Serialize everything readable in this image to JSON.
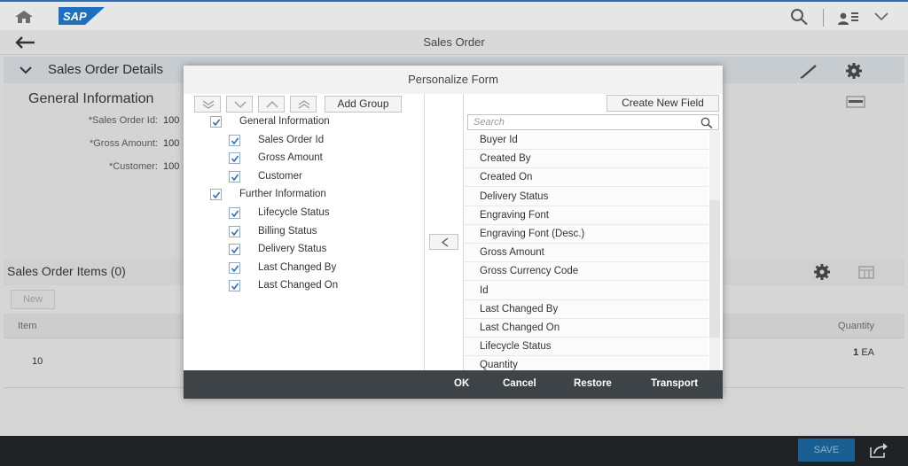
{
  "colors": {
    "accent": "#2a6ebb",
    "sap_blue": "#1f6fbf",
    "footer": "#1f2326",
    "dialog_footer": "#3d4347",
    "save": "#1a5f91",
    "checkbox": "#2a6ebb"
  },
  "shell": {
    "logo_text": "SAP",
    "icons": [
      "home-icon",
      "search-icon",
      "user-icon",
      "chevron-down-icon"
    ]
  },
  "nav": {
    "title": "Sales Order"
  },
  "section": {
    "title": "Sales Order Details"
  },
  "form": {
    "group_title": "General Information",
    "fields": [
      {
        "label": "*Sales Order Id:",
        "value": "100"
      },
      {
        "label": "*Gross Amount:",
        "value": "100"
      },
      {
        "label": "*Customer:",
        "value": "100"
      }
    ]
  },
  "items": {
    "title": "Sales Order Items (0)",
    "new_label": "New",
    "columns": {
      "item": "Item",
      "quantity": "Quantity"
    },
    "rows": [
      {
        "item": "10",
        "qty_value": "1",
        "qty_unit": "EA"
      }
    ]
  },
  "footer": {
    "save_label": "SAVE"
  },
  "dialog": {
    "title": "Personalize Form",
    "add_group_label": "Add Group",
    "create_field_label": "Create New Field",
    "search_placeholder": "Search",
    "tree": [
      {
        "label": "General Information",
        "level": 0,
        "checked": true
      },
      {
        "label": "Sales Order Id",
        "level": 1,
        "checked": true
      },
      {
        "label": "Gross Amount",
        "level": 1,
        "checked": true
      },
      {
        "label": "Customer",
        "level": 1,
        "checked": true
      },
      {
        "label": "Further Information",
        "level": 0,
        "checked": true
      },
      {
        "label": "Lifecycle Status",
        "level": 1,
        "checked": true
      },
      {
        "label": "Billing Status",
        "level": 1,
        "checked": true
      },
      {
        "label": "Delivery Status",
        "level": 1,
        "checked": true
      },
      {
        "label": "Last Changed By",
        "level": 1,
        "checked": true
      },
      {
        "label": "Last Changed On",
        "level": 1,
        "checked": true
      }
    ],
    "available_fields": [
      "Buyer Id",
      "Created By",
      "Created On",
      "Delivery Status",
      "Engraving Font",
      "Engraving Font (Desc.)",
      "Gross Amount",
      "Gross Currency Code",
      "Id",
      "Last Changed By",
      "Last Changed On",
      "Lifecycle Status",
      "Quantity"
    ],
    "buttons": {
      "ok": "OK",
      "cancel": "Cancel",
      "restore": "Restore",
      "transport": "Transport"
    }
  }
}
